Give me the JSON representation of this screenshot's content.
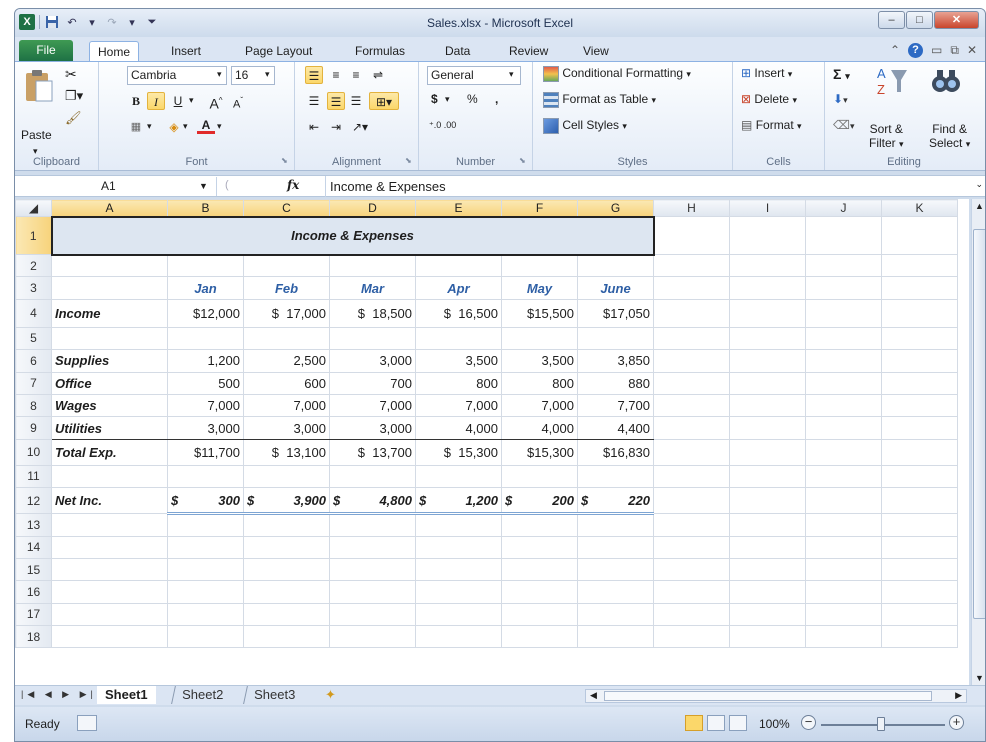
{
  "window": {
    "title": "Sales.xlsx - Microsoft Excel"
  },
  "tabs": [
    "File",
    "Home",
    "Insert",
    "Page Layout",
    "Formulas",
    "Data",
    "Review",
    "View"
  ],
  "ribbon": {
    "clipboard": {
      "label": "Clipboard",
      "paste": "Paste"
    },
    "font": {
      "label": "Font",
      "name": "Cambria",
      "size": "16"
    },
    "alignment": {
      "label": "Alignment"
    },
    "number": {
      "label": "Number",
      "format": "General",
      "currency": "$",
      "percent": "%",
      "comma": ","
    },
    "styles": {
      "label": "Styles",
      "conditional": "Conditional Formatting",
      "format_table": "Format as Table",
      "cell_styles": "Cell Styles"
    },
    "cells": {
      "label": "Cells",
      "insert": "Insert",
      "delete": "Delete",
      "format": "Format"
    },
    "editing": {
      "label": "Editing",
      "sort1": "Sort &",
      "sort2": "Filter",
      "find1": "Find &",
      "find2": "Select"
    }
  },
  "formula_bar": {
    "name_box": "A1",
    "fx": "fx",
    "content": "Income & Expenses"
  },
  "columns": [
    "A",
    "B",
    "C",
    "D",
    "E",
    "F",
    "G",
    "H",
    "I",
    "J",
    "K"
  ],
  "sheet": {
    "title": "Income & Expenses",
    "months": [
      "Jan",
      "Feb",
      "Mar",
      "Apr",
      "May",
      "June"
    ],
    "rows": [
      {
        "row": "4",
        "label": "Income",
        "values": [
          "$12,000",
          "$  17,000",
          "$  18,500",
          "$  16,500",
          "$15,500",
          "$17,050"
        ]
      },
      {
        "row": "6",
        "label": "Supplies",
        "values": [
          "1,200",
          "2,500",
          "3,000",
          "3,500",
          "3,500",
          "3,850"
        ]
      },
      {
        "row": "7",
        "label": "Office",
        "values": [
          "500",
          "600",
          "700",
          "800",
          "800",
          "880"
        ]
      },
      {
        "row": "8",
        "label": "Wages",
        "values": [
          "7,000",
          "7,000",
          "7,000",
          "7,000",
          "7,000",
          "7,700"
        ]
      },
      {
        "row": "9",
        "label": "Utilities",
        "values": [
          "3,000",
          "3,000",
          "3,000",
          "4,000",
          "4,000",
          "4,400"
        ]
      },
      {
        "row": "10",
        "label": "Total Exp.",
        "values": [
          "$11,700",
          "$  13,100",
          "$  13,700",
          "$  15,300",
          "$15,300",
          "$16,830"
        ]
      },
      {
        "row": "12",
        "label": "Net Inc.",
        "values": [
          "300",
          "3,900",
          "4,800",
          "1,200",
          "200",
          "220"
        ]
      }
    ],
    "net_symbol": "$"
  },
  "sheet_tabs": [
    "Sheet1",
    "Sheet2",
    "Sheet3"
  ],
  "status": {
    "ready": "Ready",
    "zoom": "100%"
  }
}
